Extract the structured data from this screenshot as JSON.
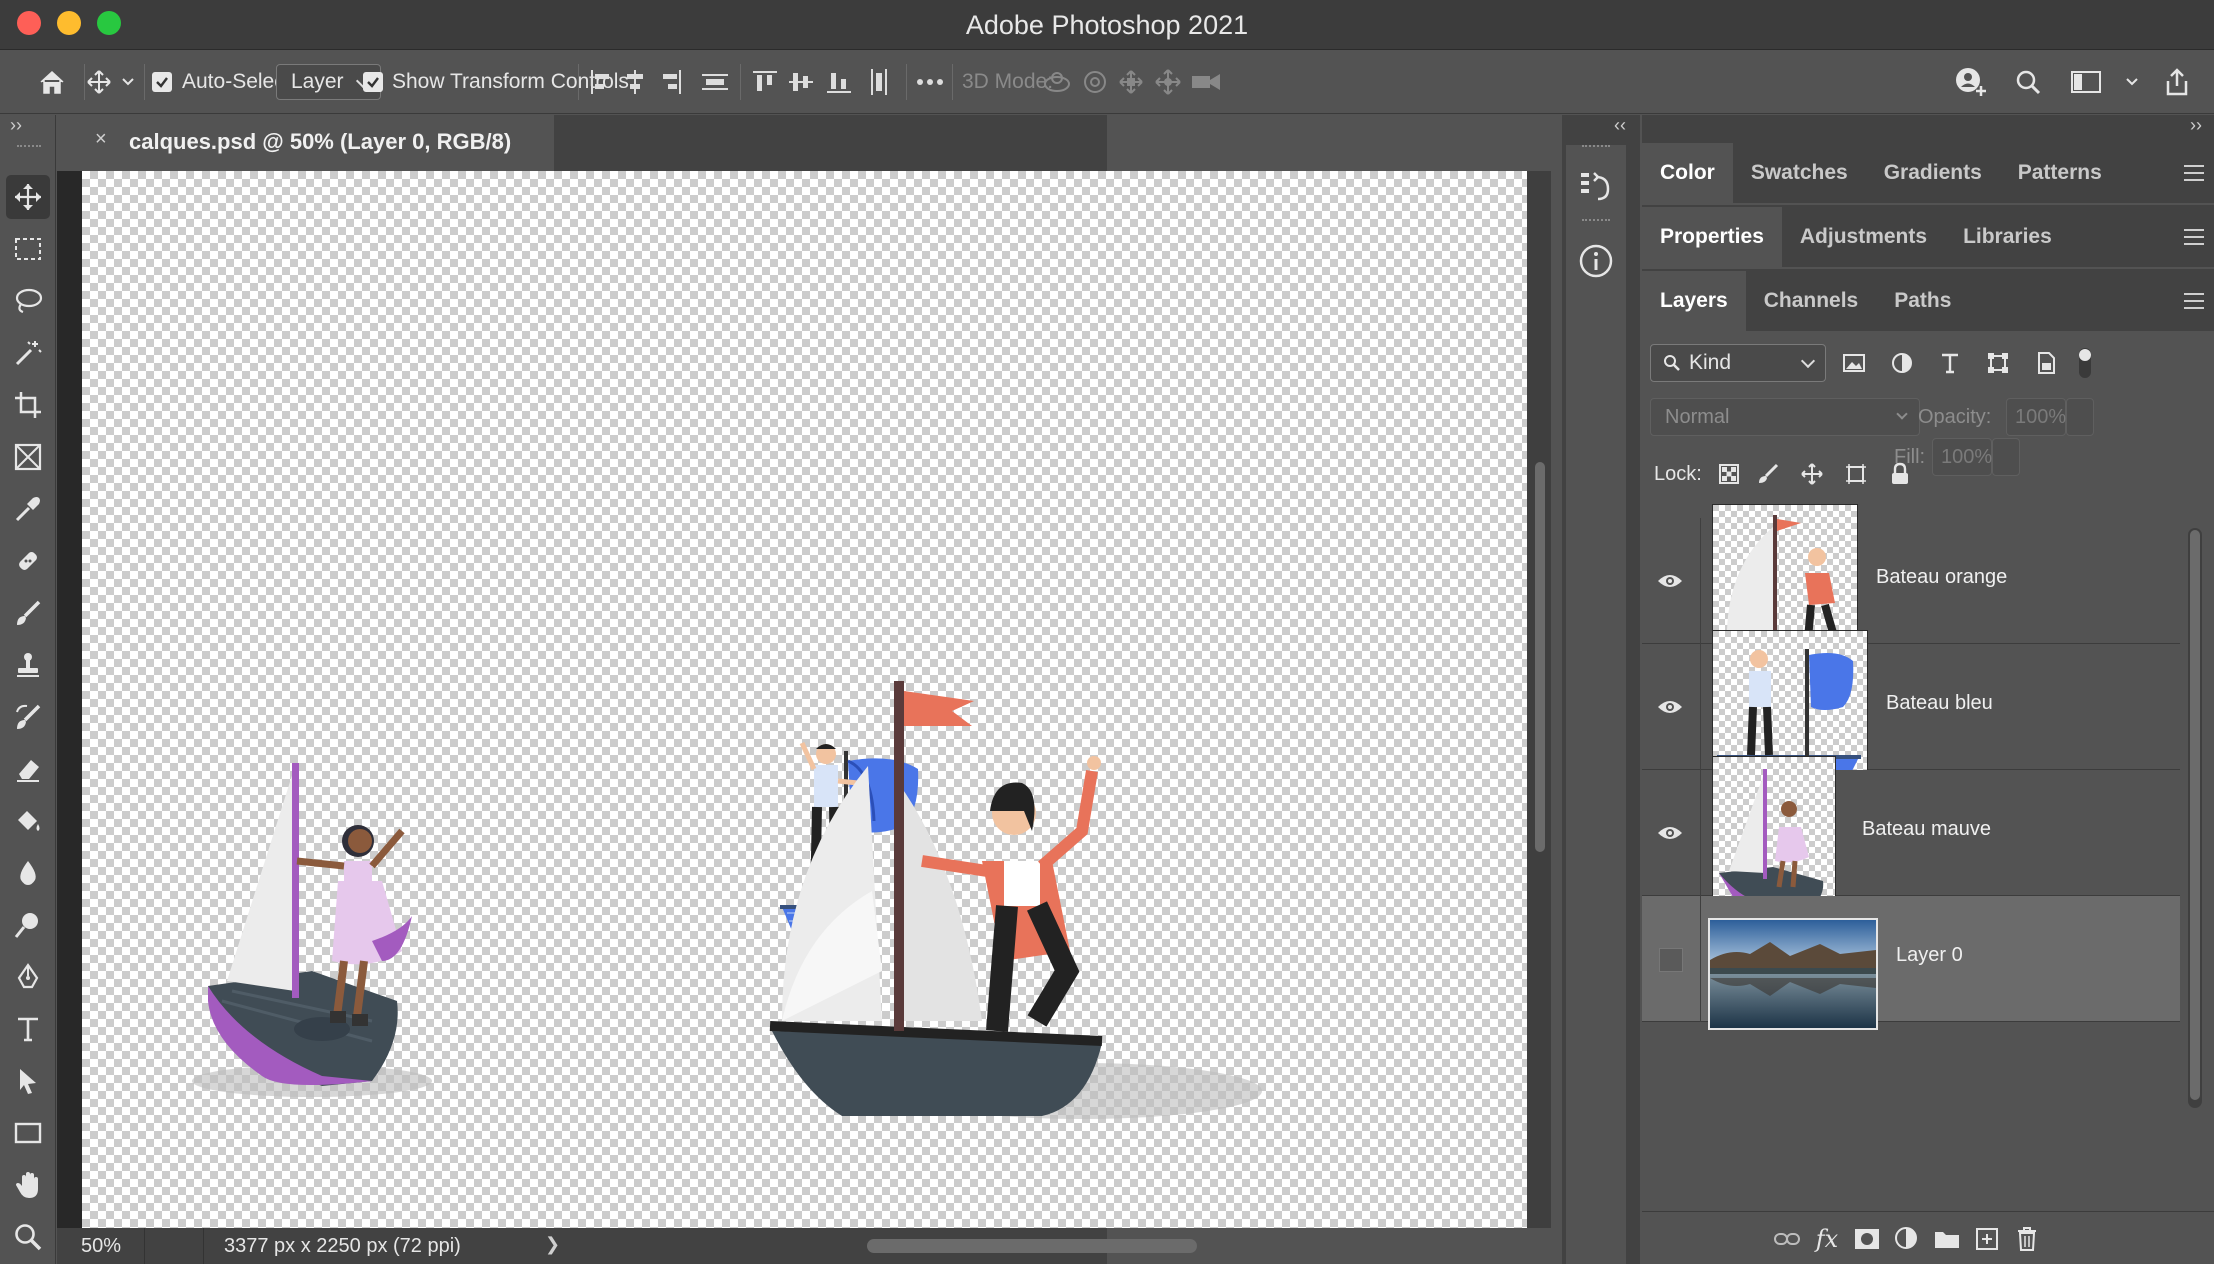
{
  "window": {
    "title": "Adobe Photoshop 2021"
  },
  "options_bar": {
    "auto_select_label": "Auto-Select:",
    "auto_select_checked": true,
    "auto_select_target": "Layer",
    "show_transform_label": "Show Transform Controls",
    "show_transform_checked": true,
    "mode_3d_label": "3D Mode:"
  },
  "toolbar": {
    "collapse_glyph": "››",
    "tools": [
      "move-tool",
      "rectangular-marquee-tool",
      "lasso-tool",
      "magic-wand-tool",
      "crop-tool",
      "frame-tool",
      "eyedropper-tool",
      "healing-brush-tool",
      "brush-tool",
      "clone-stamp-tool",
      "history-brush-tool",
      "eraser-tool",
      "paint-bucket-tool",
      "blur-tool",
      "dodge-tool",
      "pen-tool",
      "type-tool",
      "path-selection-tool",
      "rectangle-tool",
      "hand-tool",
      "zoom-tool"
    ],
    "active_tool": "move-tool"
  },
  "document": {
    "tab_close": "×",
    "tab_title": "calques.psd @ 50% (Layer 0, RGB/8)",
    "zoom": "50%",
    "info": "3377 px x 2250 px (72 ppi)",
    "info_arrow": "❯"
  },
  "right_panels": {
    "group1_tabs": [
      "Color",
      "Swatches",
      "Gradients",
      "Patterns"
    ],
    "group1_active": "Color",
    "group2_tabs": [
      "Properties",
      "Adjustments",
      "Libraries"
    ],
    "group2_active": "Properties",
    "group3_tabs": [
      "Layers",
      "Channels",
      "Paths"
    ],
    "group3_active": "Layers",
    "collapse_glyph": "‹‹",
    "expand_glyph": "››"
  },
  "layers_panel": {
    "filter_kind": "Kind",
    "blend_mode": "Normal",
    "opacity_label": "Opacity:",
    "opacity_value": "100%",
    "lock_label": "Lock:",
    "fill_label": "Fill:",
    "fill_value": "100%",
    "layers": [
      {
        "name": "Bateau orange",
        "visible": true,
        "selected": false
      },
      {
        "name": "Bateau bleu",
        "visible": true,
        "selected": false
      },
      {
        "name": "Bateau mauve",
        "visible": true,
        "selected": false
      },
      {
        "name": "Layer 0",
        "visible": false,
        "selected": true
      }
    ],
    "footer_fx": "fx"
  },
  "colors": {
    "boat_orange_accent": "#e8735a",
    "boat_blue_accent": "#4a76e8",
    "boat_mauve_accent": "#a35bbf",
    "hull_dark": "#404c55"
  }
}
